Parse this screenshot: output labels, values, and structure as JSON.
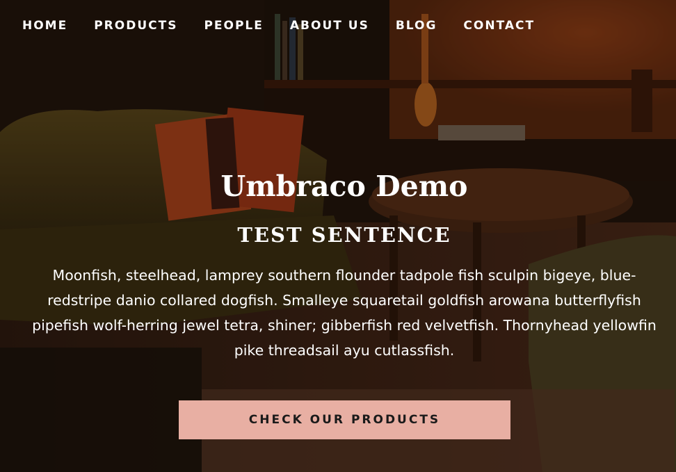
{
  "nav": {
    "items": [
      {
        "label": "HOME"
      },
      {
        "label": "PRODUCTS"
      },
      {
        "label": "PEOPLE"
      },
      {
        "label": "ABOUT US"
      },
      {
        "label": "BLOG"
      },
      {
        "label": "CONTACT"
      }
    ]
  },
  "hero": {
    "title": "Umbraco Demo",
    "subtitle": "TEST SENTENCE",
    "body": "Moonfish, steelhead, lamprey southern flounder tadpole fish sculpin bigeye, blue-redstripe danio collared dogfish. Smalleye squaretail goldfish arowana butterflyfish pipefish wolf-herring jewel tetra, shiner; gibberfish red velvetfish. Thornyhead yellowfin pike threadsail ayu cutlassfish.",
    "cta_label": "CHECK OUR PRODUCTS"
  },
  "colors": {
    "cta_background": "#e8afa3",
    "text": "#ffffff"
  }
}
